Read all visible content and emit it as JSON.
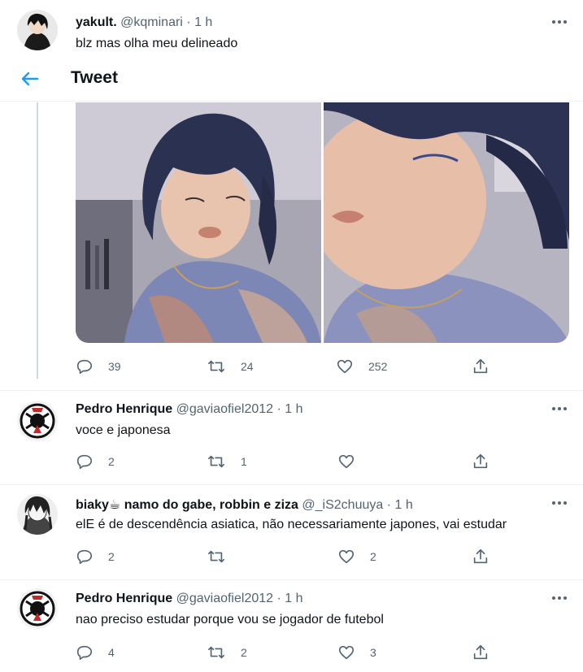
{
  "top_tweet": {
    "name": "yakult.",
    "handle": "@kqminari",
    "dot": "·",
    "time": "1 h",
    "text": "blz mas olha meu delineado"
  },
  "header": {
    "title": "Tweet"
  },
  "main_tweet": {
    "stats": {
      "replies": "39",
      "retweets": "24",
      "likes": "252"
    }
  },
  "replies": [
    {
      "name": "Pedro Henrique",
      "handle": "@gaviaofiel2012",
      "dot": "·",
      "time": "1 h",
      "text": "voce e japonesa",
      "replies": "2",
      "retweets": "1",
      "likes": ""
    },
    {
      "name": "biaky☕ namo do gabe, robbin e ziza",
      "handle": "@_iS2chuuya",
      "dot": "·",
      "time": "1 h",
      "text": "elE é de descendência asiatica, não necessariamente japones, vai estudar",
      "replies": "2",
      "retweets": "",
      "likes": "2"
    },
    {
      "name": "Pedro Henrique",
      "handle": "@gaviaofiel2012",
      "dot": "·",
      "time": "1 h",
      "text": "nao preciso estudar porque vou se jogador de futebol",
      "replies": "4",
      "retweets": "2",
      "likes": "3"
    }
  ],
  "colors": {
    "accent": "#1d9bf0",
    "text": "#0f1419",
    "muted": "#536471",
    "line": "#cfd9de"
  },
  "icons": [
    "back-arrow-icon",
    "more-icon",
    "reply-icon",
    "retweet-icon",
    "like-icon",
    "share-icon"
  ]
}
